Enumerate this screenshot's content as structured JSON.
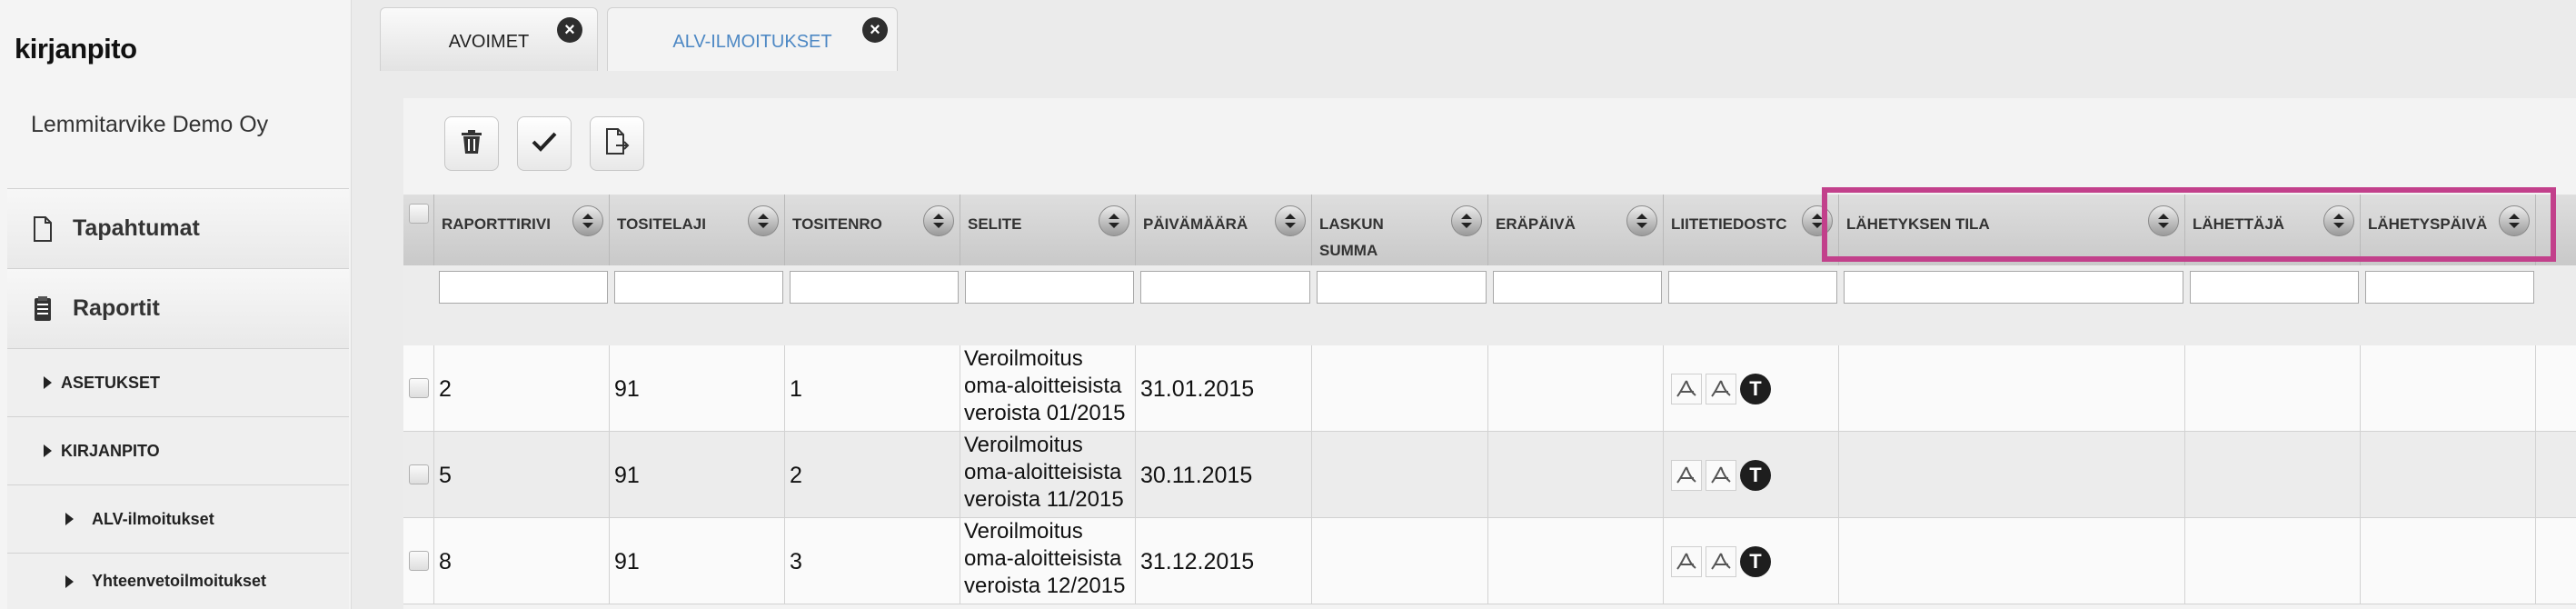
{
  "sidebar": {
    "brand": "kirjanpito",
    "company": "Lemmitarvike Demo Oy",
    "items": [
      {
        "label": "Tapahtumat",
        "icon": "document-icon"
      },
      {
        "label": "Raportit",
        "icon": "report-icon"
      },
      {
        "label": "ASETUKSET"
      },
      {
        "label": "KIRJANPITO"
      },
      {
        "label": "ALV-ilmoitukset"
      },
      {
        "label": "Yhteenvetoilmoitukset"
      }
    ]
  },
  "tabs": [
    {
      "label": "AVOIMET",
      "active": false
    },
    {
      "label": "ALV-ILMOITUKSET",
      "active": true
    }
  ],
  "toolbar": {
    "buttons": [
      "trash-icon",
      "check-icon",
      "export-document-icon"
    ]
  },
  "grid": {
    "columns": [
      "RAPORTTIRIVI",
      "TOSITELAJI",
      "TOSITENRO",
      "SELITE",
      "PÄIVÄMÄÄRÄ",
      "LASKUN SUMMA",
      "ERÄPÄIVÄ",
      "LIITETIEDOSTC",
      "LÄHETYKSEN TILA",
      "LÄHETTÄJÄ",
      "LÄHETYSPÄIVÄ"
    ],
    "rows": [
      {
        "raporttirivi": "2",
        "tositelaji": "91",
        "tositenro": "1",
        "selite": [
          "Veroilmoitus",
          "oma-aloitteisista",
          "veroista 01/2015"
        ],
        "paivamaara": "31.01.2015",
        "laskun_summa": "",
        "erapaiva": "",
        "lahetyksen_tila": "",
        "lahettaja": "",
        "lahetyspaiva": ""
      },
      {
        "raporttirivi": "5",
        "tositelaji": "91",
        "tositenro": "2",
        "selite": [
          "Veroilmoitus",
          "oma-aloitteisista",
          "veroista 11/2015"
        ],
        "paivamaara": "30.11.2015",
        "laskun_summa": "",
        "erapaiva": "",
        "lahetyksen_tila": "",
        "lahettaja": "",
        "lahetyspaiva": ""
      },
      {
        "raporttirivi": "8",
        "tositelaji": "91",
        "tositenro": "3",
        "selite": [
          "Veroilmoitus",
          "oma-aloitteisista",
          "veroista 12/2015"
        ],
        "paivamaara": "31.12.2015",
        "laskun_summa": "",
        "erapaiva": "",
        "lahetyksen_tila": "",
        "lahettaja": "",
        "lahetyspaiva": ""
      }
    ],
    "attachment_icons": [
      "pdf-icon",
      "pdf-icon",
      "t-icon"
    ],
    "attachment_t_label": "T"
  },
  "colors": {
    "highlight": "#c2408b",
    "active_tab_text": "#4d88c4"
  }
}
